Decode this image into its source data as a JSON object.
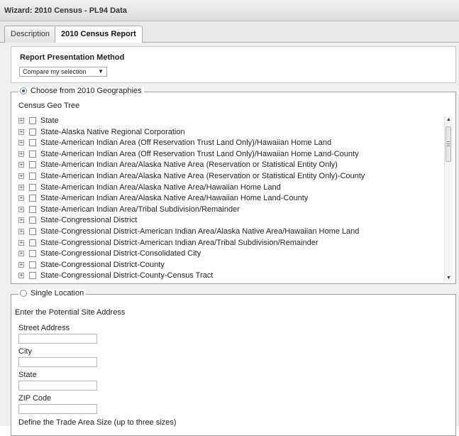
{
  "window": {
    "title": "Wizard: 2010 Census - PL94 Data"
  },
  "tabs": [
    {
      "label": "Description",
      "active": false
    },
    {
      "label": "2010 Census Report",
      "active": true
    }
  ],
  "report_method": {
    "heading": "Report Presentation Method",
    "dropdown": {
      "selected": "Compare my selection",
      "arrow": "▼"
    }
  },
  "geographies": {
    "radio_label": "Choose from 2010 Geographies",
    "selected": true,
    "tree_label": "Census Geo Tree",
    "expander_glyph": "+",
    "items": [
      "State",
      "State-Alaska Native Regional Corporation",
      "State-American Indian Area (Off Reservation Trust Land Only)/Hawaiian Home Land",
      "State-American Indian Area (Off Reservation Trust Land Only)/Hawaiian Home Land-County",
      "State-American Indian Area/Alaska Native Area (Reservation or Statistical Entity Only)",
      "State-American Indian Area/Alaska Native Area (Reservation or Statistical Entity Only)-County",
      "State-American Indian Area/Alaska Native Area/Hawaiian Home Land",
      "State-American Indian Area/Alaska Native Area/Hawaiian Home Land-County",
      "State-American Indian Area/Tribal Subdivision/Remainder",
      "State-Congressional District",
      "State-Congressional District-American Indian Area/Alaska Native Area/Hawaiian Home Land",
      "State-Congressional District-American Indian Area/Tribal Subdivision/Remainder",
      "State-Congressional District-Consolidated City",
      "State-Congressional District-County",
      "State-Congressional District-County-Census Tract"
    ],
    "scroll_up": "▲",
    "scroll_down": "▼"
  },
  "single_location": {
    "radio_label": "Single Location",
    "selected": false,
    "intro": "Enter the Potential Site Address",
    "fields": [
      {
        "label": "Street Address",
        "value": ""
      },
      {
        "label": "City",
        "value": ""
      },
      {
        "label": "State",
        "value": ""
      },
      {
        "label": "ZIP Code",
        "value": ""
      }
    ],
    "trade_area_label": "Define the Trade Area Size (up to three sizes)"
  }
}
